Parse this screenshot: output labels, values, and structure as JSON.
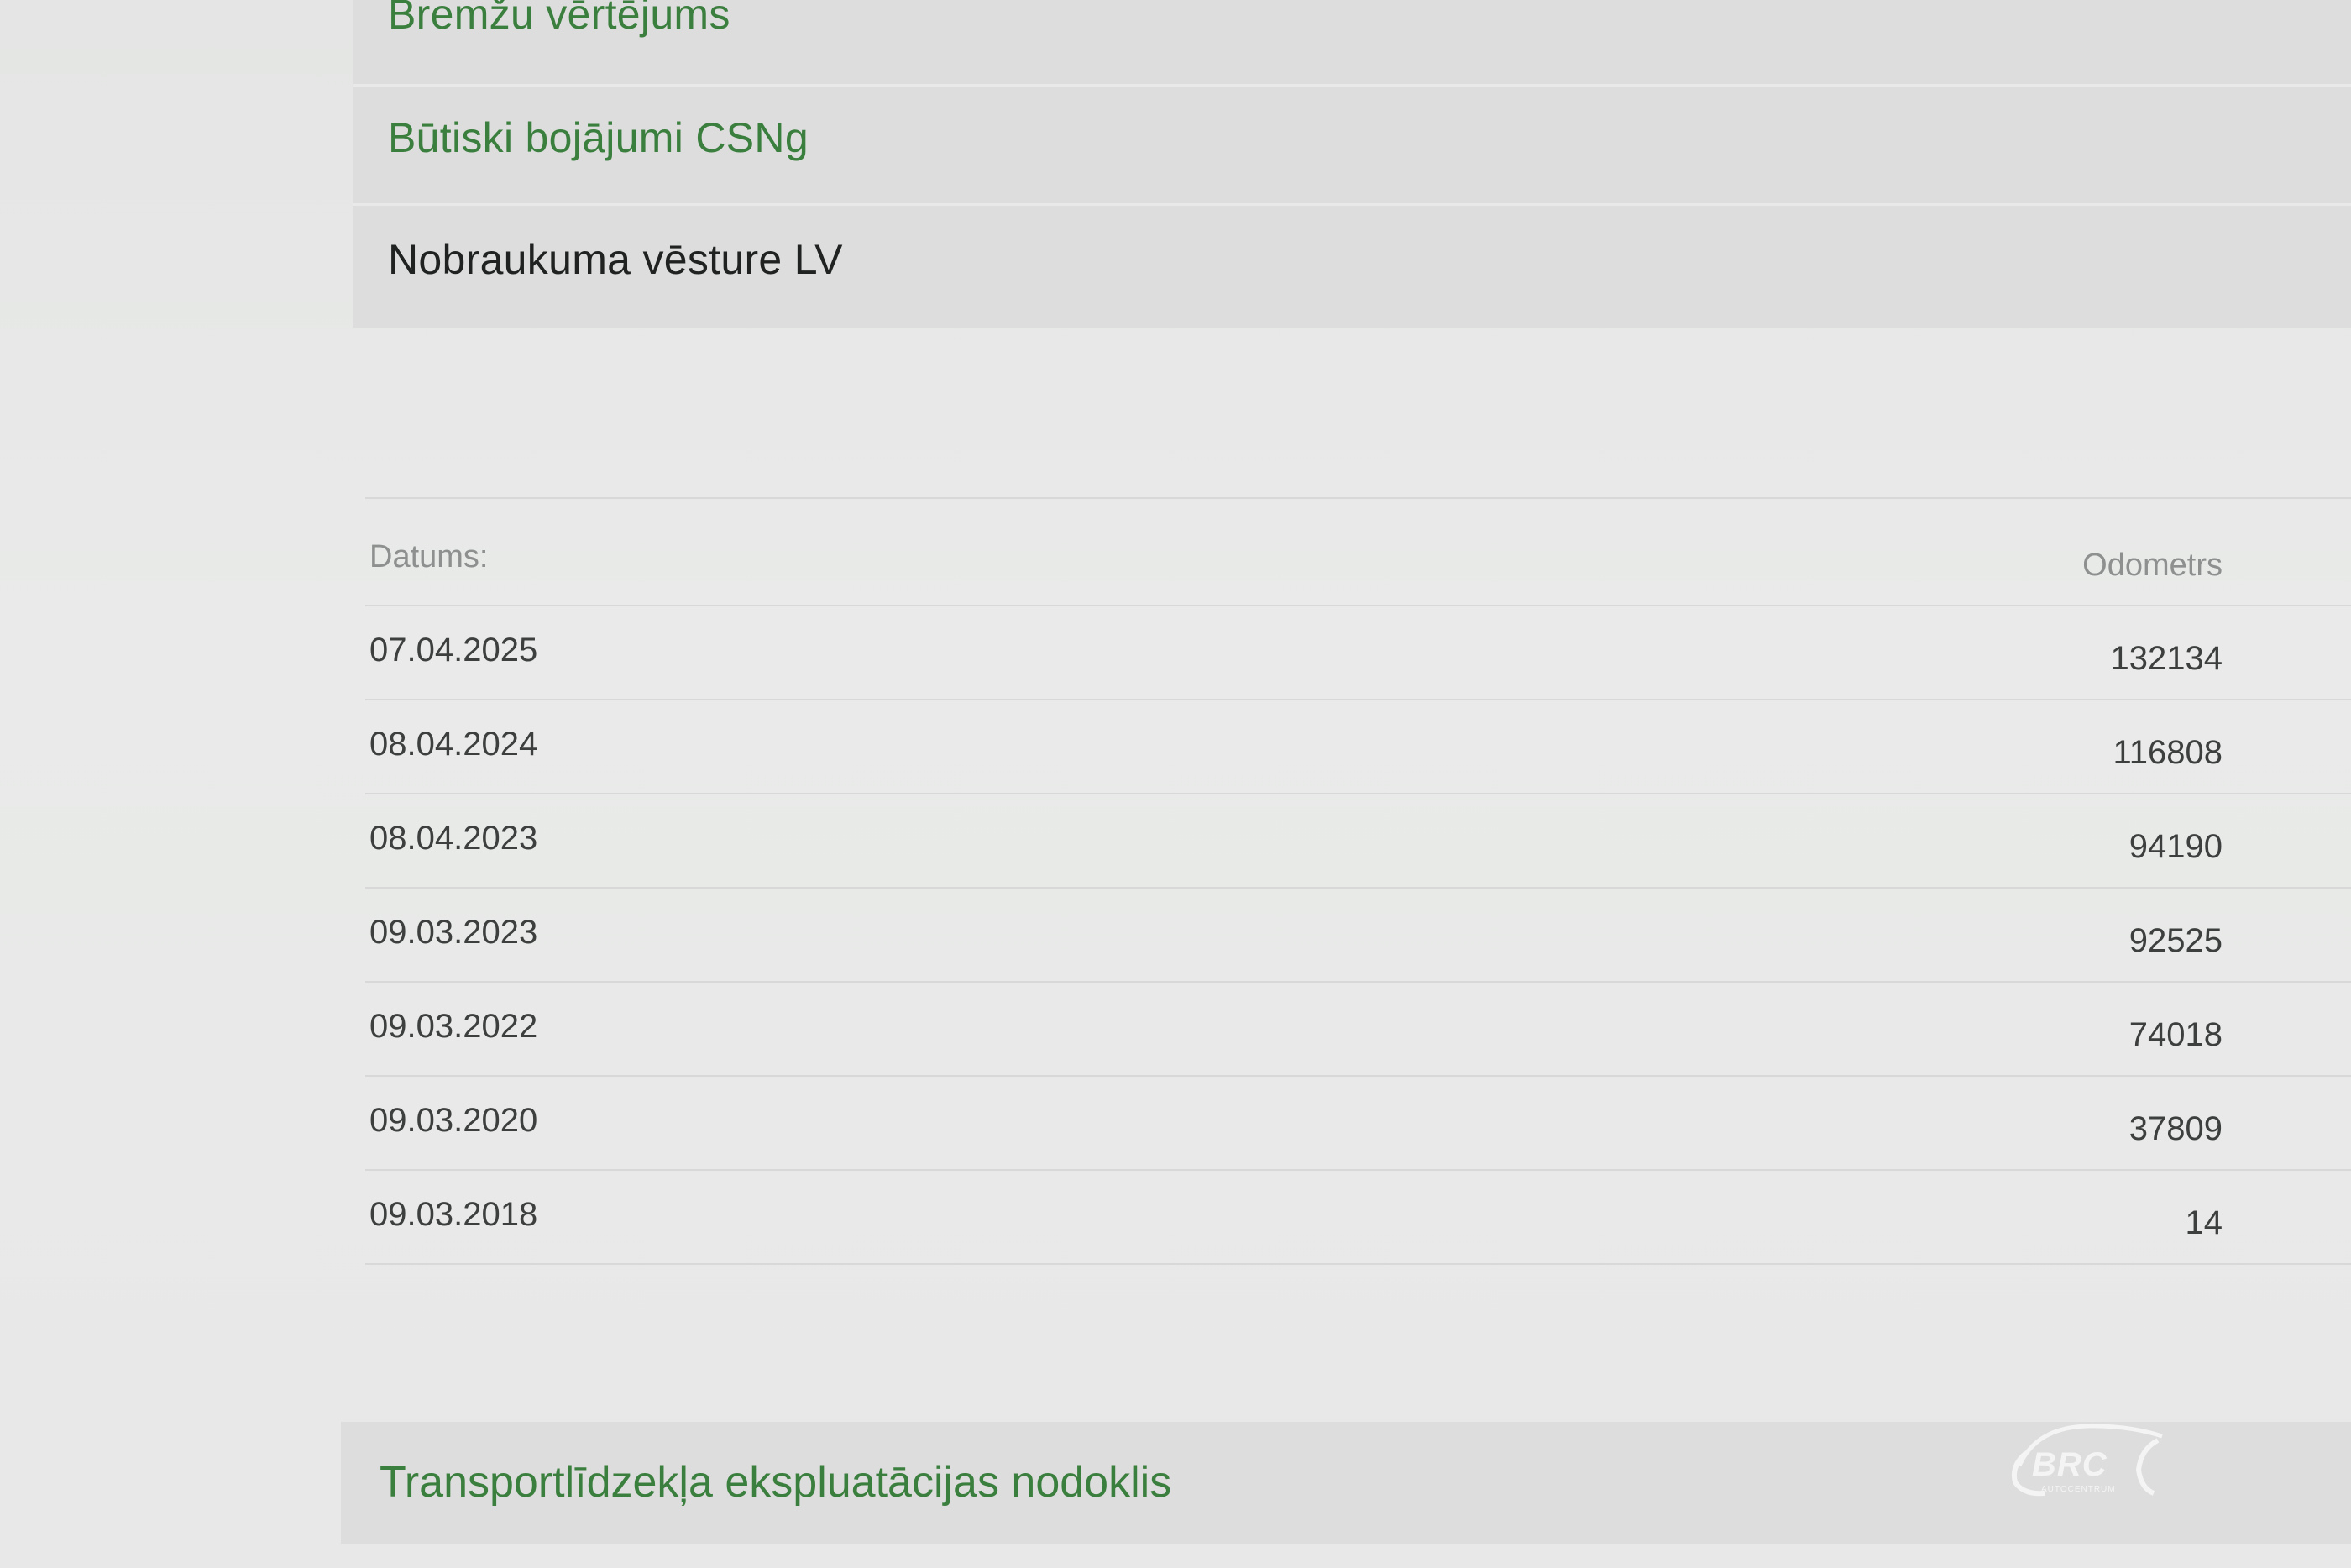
{
  "menu": {
    "items": [
      {
        "label": "Bremžu vērtējums"
      },
      {
        "label": "Būtiski bojājumi CSNg"
      },
      {
        "label": "Nobraukuma vēsture LV"
      }
    ]
  },
  "table": {
    "headers": {
      "date": "Datums:",
      "odometer": "Odometrs"
    },
    "rows": [
      {
        "date": "07.04.2025",
        "odometer": "132134"
      },
      {
        "date": "08.04.2024",
        "odometer": "116808"
      },
      {
        "date": "08.04.2023",
        "odometer": "94190"
      },
      {
        "date": "09.03.2023",
        "odometer": "92525"
      },
      {
        "date": "09.03.2022",
        "odometer": "74018"
      },
      {
        "date": "09.03.2020",
        "odometer": "37809"
      },
      {
        "date": "09.03.2018",
        "odometer": "14"
      }
    ]
  },
  "footer": {
    "title": "Transportlīdzekļa ekspluatācijas nodoklis"
  },
  "logo": {
    "text": "BRC",
    "subtext": "AUTOCENTRUM"
  }
}
